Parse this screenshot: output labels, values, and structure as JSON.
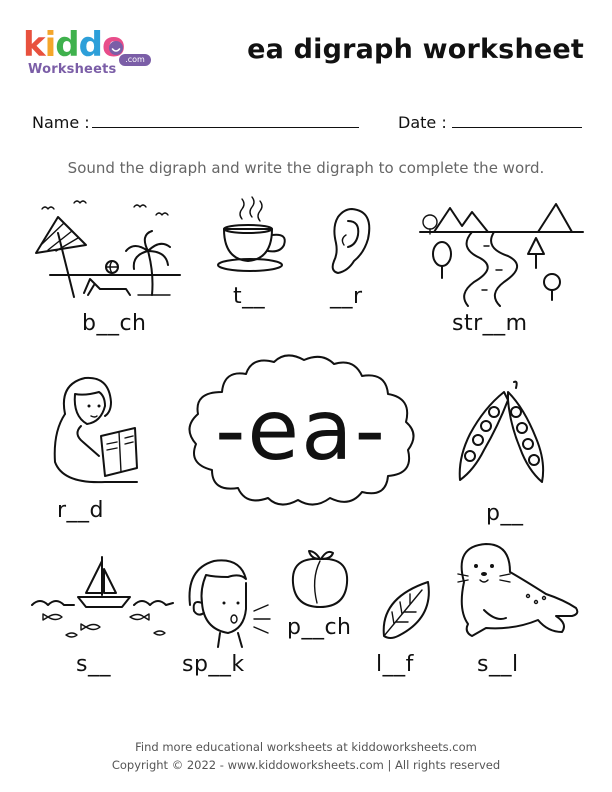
{
  "logo": {
    "letters": [
      {
        "ch": "k",
        "color": "#e8513e"
      },
      {
        "ch": "i",
        "color": "#f4a62a"
      },
      {
        "ch": "d",
        "color": "#3fb14d"
      },
      {
        "ch": "d",
        "color": "#2d9fd9"
      },
      {
        "ch": "o",
        "color": "#e84d8a"
      }
    ],
    "subtitle": "Worksheets",
    "badge": ".com"
  },
  "title": "ea digraph worksheet",
  "form": {
    "name_label": "Name :",
    "date_label": "Date :"
  },
  "instruction": "Sound the digraph and write the digraph to complete the word.",
  "center_digraph": "-ea-",
  "words": {
    "beach": "b__ch",
    "tea": "t__",
    "ear": "__r",
    "stream": "str__m",
    "read": "r__d",
    "pea": "p__",
    "sea": "s__",
    "speak": "sp__k",
    "peach": "p__ch",
    "leaf": "l__f",
    "seal": "s__l"
  },
  "footer": {
    "line1": "Find more educational worksheets at kiddoworksheets.com",
    "line2": "Copyright © 2022 - www.kiddoworksheets.com  |  All rights reserved"
  },
  "icons": [
    "beach-icon",
    "teacup-icon",
    "ear-icon",
    "stream-icon",
    "girl-reading-icon",
    "pea-pod-icon",
    "sea-boat-icon",
    "boy-speaking-icon",
    "peach-icon",
    "leaf-icon",
    "seal-icon",
    "smile-icon"
  ]
}
